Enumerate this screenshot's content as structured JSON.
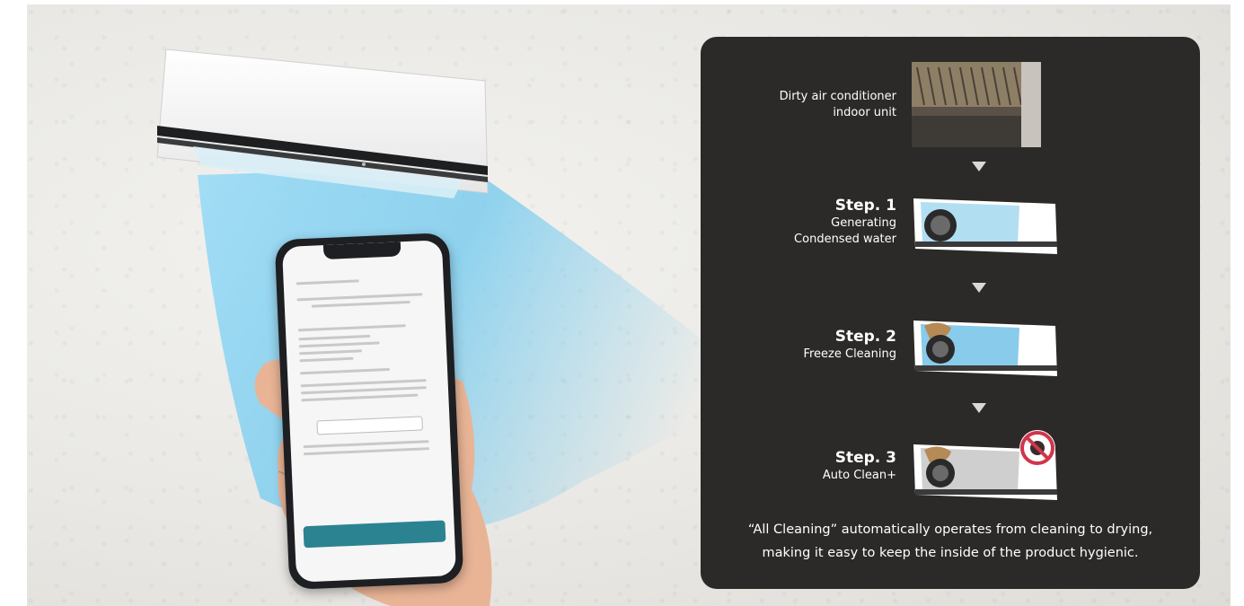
{
  "panel": {
    "dirty_label": "Dirty air conditioner indoor unit",
    "steps": [
      {
        "title": "Step. 1",
        "desc_line1": "Generating",
        "desc_line2": "Condensed water"
      },
      {
        "title": "Step. 2",
        "desc_line1": "Freeze Cleaning",
        "desc_line2": ""
      },
      {
        "title": "Step. 3",
        "desc_line1": "Auto Clean+",
        "desc_line2": ""
      }
    ],
    "caption_line1": "“All Cleaning” automatically operates from cleaning to drying,",
    "caption_line2": "making it easy to keep the inside of the product hygienic."
  },
  "colors": {
    "panel_bg": "#2b2a28",
    "airflow": "#6fc8ee",
    "app_button": "#2b8392"
  },
  "icons": [
    "down-arrow-icon",
    "no-germs-icon"
  ]
}
